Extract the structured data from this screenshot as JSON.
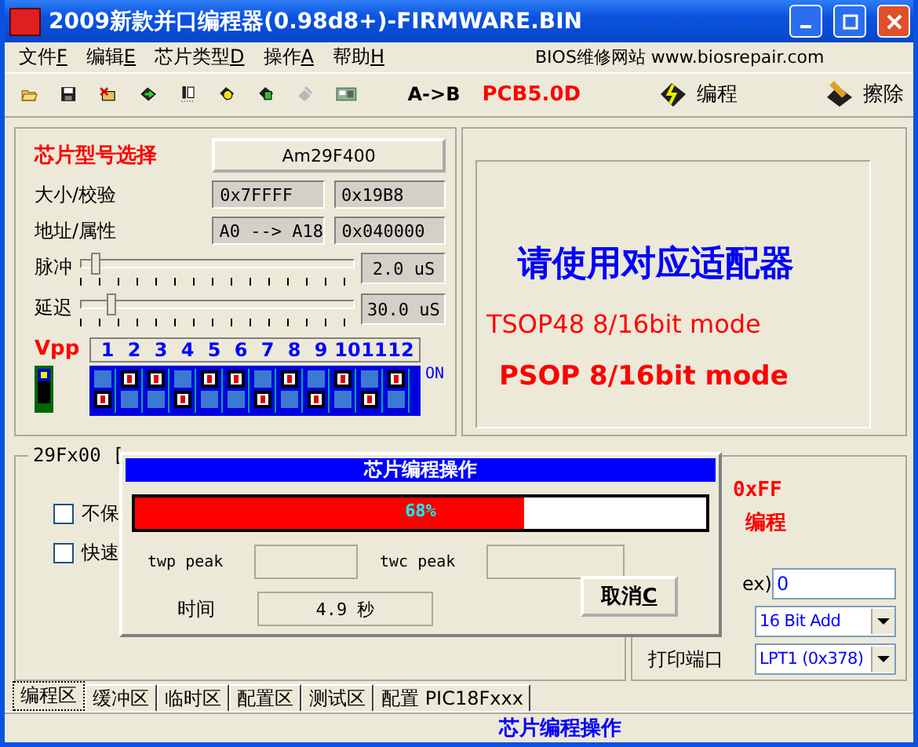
{
  "window": {
    "title": "2009新款并口编程器(0.98d8+)-FIRMWARE.BIN"
  },
  "menu": [
    {
      "label": "文件",
      "accel": "F"
    },
    {
      "label": "编辑",
      "accel": "E"
    },
    {
      "label": "芯片类型",
      "accel": "D"
    },
    {
      "label": "操作",
      "accel": "A"
    },
    {
      "label": "帮助",
      "accel": "H"
    }
  ],
  "website": "BIOS维修网站 www.biosrepair.com",
  "toolbar": {
    "icons": [
      {
        "kind": "open",
        "disabled": false
      },
      {
        "kind": "save",
        "disabled": false
      },
      {
        "kind": "chip_cross",
        "disabled": false
      },
      {
        "kind": "chip_green",
        "disabled": false
      },
      {
        "kind": "chip_list",
        "disabled": false
      },
      {
        "kind": "chip_yellow",
        "disabled": false
      },
      {
        "kind": "chip_id",
        "disabled": false
      },
      {
        "kind": "chip_pen",
        "disabled": true
      },
      {
        "kind": "board",
        "disabled": false
      }
    ],
    "copy_label": "A->B",
    "pcb_version": "PCB5.0D",
    "program_button": "编程",
    "erase_button": "擦除"
  },
  "chip": {
    "heading": "芯片型号选择",
    "model": "Am29F400",
    "rows": [
      {
        "label": "大小/校验",
        "values": [
          "0x7FFFF",
          "0x19B8"
        ]
      },
      {
        "label": "地址/属性",
        "values": [
          "A0 --> A18",
          "0x040000"
        ]
      }
    ],
    "sliders": [
      {
        "label": "脉冲",
        "level": 0.04,
        "reading": "2.0 uS"
      },
      {
        "label": "延迟",
        "level": 0.1,
        "reading": "30.0 uS"
      }
    ]
  },
  "vpp": {
    "label": "Vpp",
    "on": true,
    "on_label": "ON",
    "switches": [
      {
        "number": "1",
        "on": false
      },
      {
        "number": "2",
        "on": true
      },
      {
        "number": "3",
        "on": true
      },
      {
        "number": "4",
        "on": false
      },
      {
        "number": "5",
        "on": true
      },
      {
        "number": "6",
        "on": true
      },
      {
        "number": "7",
        "on": false
      },
      {
        "number": "8",
        "on": true
      },
      {
        "number": "9",
        "on": false
      },
      {
        "number": "10",
        "on": true
      },
      {
        "number": "11",
        "on": false
      },
      {
        "number": "12",
        "on": true
      }
    ]
  },
  "adapter": {
    "heading": "请使用对应适配器",
    "line_1": "TSOP48 8/16bit mode",
    "line_2": "PSOP 8/16bit mode"
  },
  "options": {
    "group_title": "29Fx00 [",
    "checkboxes": [
      {
        "label": "不保",
        "checked": false
      },
      {
        "label": "快速",
        "checked": false
      }
    ],
    "notice_1": "0xFF",
    "notice_2": "编程",
    "field_label": "ex)",
    "field_value": "0",
    "bus_mode": "16 Bit Add",
    "port_label": "打印端口",
    "port": "LPT1 (0x378)"
  },
  "dialog": {
    "title": "芯片编程操作",
    "progress": {
      "level": 0.68,
      "text": "68%"
    },
    "twp_label": "twp peak",
    "twc_label": "twc peak",
    "time_label": "时间",
    "time_value": "4.9 秒",
    "cancel": {
      "label": "取消",
      "accel": "C"
    }
  },
  "tabs": [
    {
      "label": "编程区",
      "selected": true
    },
    {
      "label": "缓冲区",
      "selected": false
    },
    {
      "label": "临时区",
      "selected": false
    },
    {
      "label": "配置区",
      "selected": false
    },
    {
      "label": "测试区",
      "selected": false
    },
    {
      "label": "配置 PIC18Fxxx",
      "selected": false
    }
  ],
  "status_bar": "芯片编程操作"
}
